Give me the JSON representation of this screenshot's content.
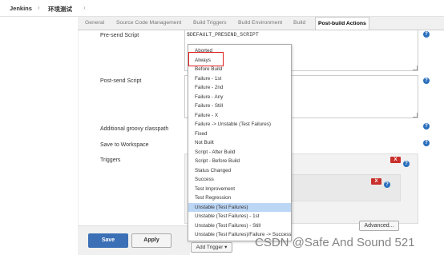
{
  "breadcrumb": {
    "root": "Jenkins",
    "sep1": "›",
    "project": "环境测试",
    "sep2": "›"
  },
  "tabs": [
    "General",
    "Source Code Management",
    "Build Triggers",
    "Build Environment",
    "Build",
    "Post-build Actions"
  ],
  "form": {
    "pre_send_label": "Pre-send Script",
    "pre_send_value": "$DEFAULT_PRESEND_SCRIPT",
    "post_send_label": "Post-send Script",
    "classpath_label": "Additional groovy classpath",
    "save_workspace_label": "Save to Workspace",
    "triggers_label": "Triggers"
  },
  "icons": {
    "help": "?",
    "remove": "X",
    "caret": "▾"
  },
  "dropdown": {
    "items": [
      "Aborted",
      "Always",
      "Before Build",
      "Failure - 1st",
      "Failure - 2nd",
      "Failure - Any",
      "Failure - Still",
      "Failure - X",
      "Failure -> Unstable (Test Failures)",
      "Fixed",
      "Not Built",
      "Script - After Build",
      "Script - Before Build",
      "Status Changed",
      "Success",
      "Test Improvement",
      "Test Regression",
      "Unstable (Test Failures)",
      "Unstable (Test Failures) - 1st",
      "Unstable (Test Failures) - Still",
      "Unstable (Test Failures)/Failure -> Success"
    ],
    "selected": "Unstable (Test Failures)",
    "highlighted": "Always"
  },
  "buttons": {
    "save": "Save",
    "apply": "Apply",
    "advanced": "Advanced...",
    "add_trigger": "Add Trigger"
  },
  "watermark": "CSDN @Safe And Sound 521",
  "colors": {
    "save_bg": "#3b6fb6",
    "highlight_border": "#e02020",
    "remove_btn": "#c9302c",
    "help": "#2a6fbd",
    "selected_item": "#bcd6f5"
  }
}
